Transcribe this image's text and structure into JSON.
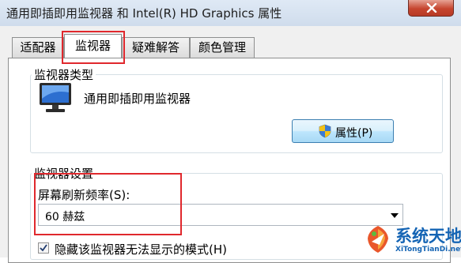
{
  "window": {
    "title": "通用即插即用监视器 和 Intel(R) HD Graphics 属性"
  },
  "tabs": [
    {
      "label": "适配器"
    },
    {
      "label": "监视器"
    },
    {
      "label": "疑难解答"
    },
    {
      "label": "颜色管理"
    }
  ],
  "monitor_type": {
    "group_title": "监视器类型",
    "monitor_name": "通用即插即用监视器",
    "properties_button": "属性(P)"
  },
  "monitor_settings": {
    "group_title": "监视器设置",
    "refresh_rate_label": "屏幕刷新频率(S):",
    "refresh_rate_value": "60 赫兹",
    "hide_modes_checkbox": {
      "label": "隐藏该监视器无法显示的模式(H)",
      "checked": true
    }
  },
  "watermark": {
    "title": "系统天地",
    "url": "XiTongTianDi.net"
  },
  "colors": {
    "highlight": "#e0282d",
    "close_button": "#c6452f",
    "watermark": "#1464b4"
  },
  "icons": [
    "close-icon",
    "monitor-icon",
    "shield-icon",
    "dropdown-arrow-icon",
    "checkmark-icon"
  ]
}
